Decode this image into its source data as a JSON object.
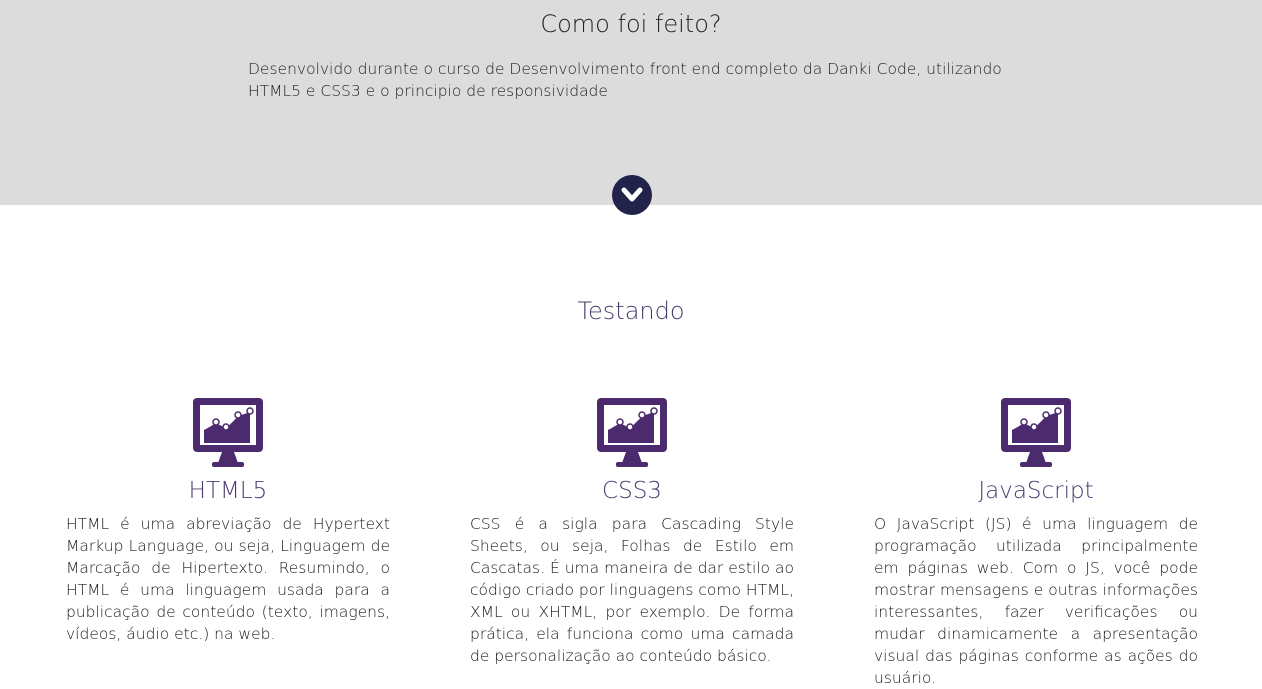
{
  "about": {
    "title": "Como foi feito?",
    "text": "Desenvolvido durante o curso de Desenvolvimento front end completo da Danki Code, utilizando HTML5 e CSS3 e o principio de responsividade"
  },
  "scroll_icon": "chevron-down-icon",
  "section": {
    "title": "Testando"
  },
  "colors": {
    "about_bg": "#dcdcdc",
    "accent_purple": "#4b2a6e",
    "button_navy": "#22234a"
  },
  "features": [
    {
      "icon": "monitor-chart-icon",
      "title": "HTML5",
      "text": "HTML é uma abreviação de Hypertext Markup Language, ou seja, Linguagem de Marcação de Hipertexto. Resumindo, o HTML é uma linguagem usada para a publicação de conteúdo (texto, imagens, vídeos, áudio etc.) na web."
    },
    {
      "icon": "monitor-chart-icon",
      "title": "CSS3",
      "text": "CSS é a sigla para Cascading Style Sheets, ou seja, Folhas de Estilo em Cascatas. É uma maneira de dar estilo ao código criado por linguagens como HTML, XML ou XHTML, por exemplo. De forma prática, ela funciona como uma camada de personalização ao conteúdo básico."
    },
    {
      "icon": "monitor-chart-icon",
      "title": "JavaScript",
      "text": "O JavaScript (JS) é uma linguagem de programação utilizada principalmente em páginas web. Com o JS, você pode mostrar mensagens e outras informações interessantes, fazer verificações ou mudar dinamicamente a apresentação visual das páginas conforme as ações do usuário."
    }
  ]
}
